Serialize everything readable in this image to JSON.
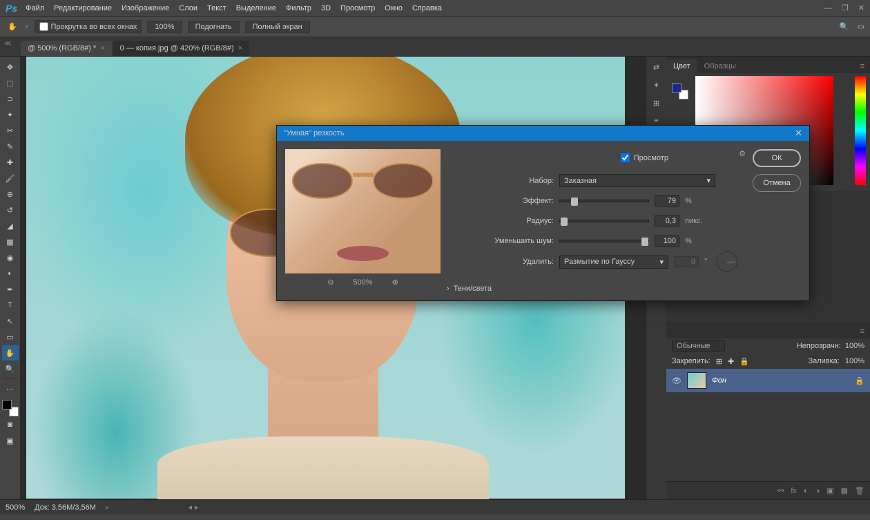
{
  "app": {
    "logo": "Ps"
  },
  "menu": [
    "Файл",
    "Редактирование",
    "Изображение",
    "Слои",
    "Текст",
    "Выделение",
    "Фильтр",
    "3D",
    "Просмотр",
    "Окно",
    "Справка"
  ],
  "optionbar": {
    "scroll_all": "Прокрутка во всех окнах",
    "zoom": "100%",
    "fit": "Подогнать",
    "fullscreen": "Полный экран"
  },
  "tabs": [
    {
      "label": "@ 500% (RGB/8#) *",
      "active": true
    },
    {
      "label": "0 — копия.jpg @ 420% (RGB/8#)",
      "active": false
    }
  ],
  "dialog": {
    "title": "\"Умная\" резкость",
    "preview_label": "Просмотр",
    "preview_zoom": "500%",
    "set_label": "Набор:",
    "set_value": "Заказная",
    "effect_label": "Эффект:",
    "effect_value": "79",
    "effect_unit": "%",
    "radius_label": "Радиус:",
    "radius_value": "0,3",
    "radius_unit": "пикс.",
    "noise_label": "Уменьшить шум:",
    "noise_value": "100",
    "noise_unit": "%",
    "remove_label": "Удалить:",
    "remove_value": "Размытие по Гауссу",
    "angle_value": "0",
    "angle_unit": "°",
    "shadows_label": "Тени/света",
    "ok": "ОК",
    "cancel": "Отмена"
  },
  "color_panel": {
    "tab1": "Цвет",
    "tab2": "Образцы"
  },
  "layers": {
    "mode": "Обычные",
    "opacity_label": "Непрозрачн:",
    "opacity_value": "100%",
    "lock_label": "Закрепить:",
    "fill_label": "Заливка:",
    "fill_value": "100%",
    "layer_name": "Фон"
  },
  "status": {
    "zoom": "500%",
    "doc": "Док: 3,56M/3,56M"
  }
}
